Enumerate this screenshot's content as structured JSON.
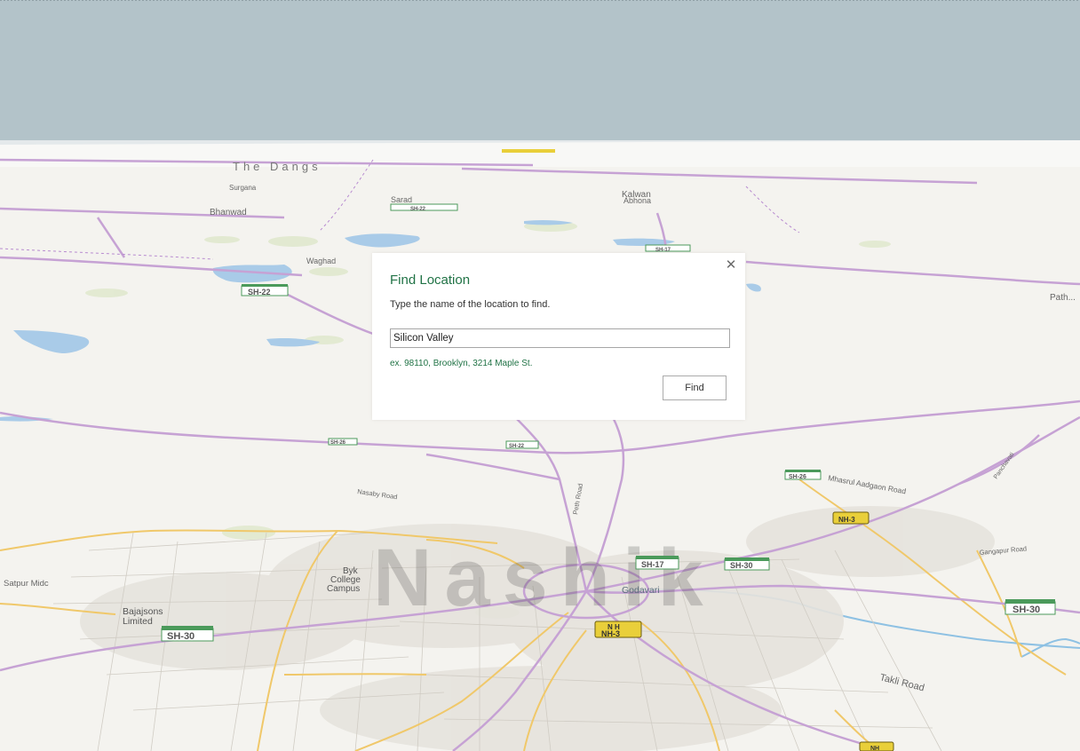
{
  "dialog": {
    "title": "Find Location",
    "instruction": "Type the name of the location to find.",
    "input_value": "Silicon Valley",
    "example": "ex. 98110, Brooklyn, 3214 Maple St.",
    "find_label": "Find",
    "close_icon": "close-icon",
    "accent_color": "#217346"
  },
  "map": {
    "city_label": "Nashik",
    "sky_color": "#b3c3c9",
    "labels": {
      "the_dangs": "The Dangs",
      "surgana": "Surgana",
      "sarad": "Sarad",
      "kalwan": "Kalwan",
      "abhona": "Abhona",
      "bhanwad": "Bhanwad",
      "waghad": "Waghad",
      "nasaby_road": "Nasaby Road",
      "byk_college": "Byk\nCollege\nCampus",
      "satpur": "Satpur Midc",
      "bajajsons": "Bajajsons\nLimited",
      "godavari": "Godavari",
      "takli_road": "Takli Road",
      "mhasrul": "Mhasrul Aadgaon Road",
      "gangapur": "Gangapur Road",
      "panchavati": "Panchavati",
      "peth_road": "Peth Road",
      "pathan": "Path..."
    },
    "shields": {
      "sh22": "SH-22",
      "sh22b": "SH-22",
      "sh26": "SH-26",
      "sh26b": "SH-26",
      "sh17": "SH-17",
      "sh17b": "SH-17",
      "sh30": "SH-30",
      "sh30b": "SH-30",
      "sh30c": "SH-30",
      "nh3": "NH-3",
      "nh3b": "NH-3",
      "nh": "NH"
    }
  }
}
